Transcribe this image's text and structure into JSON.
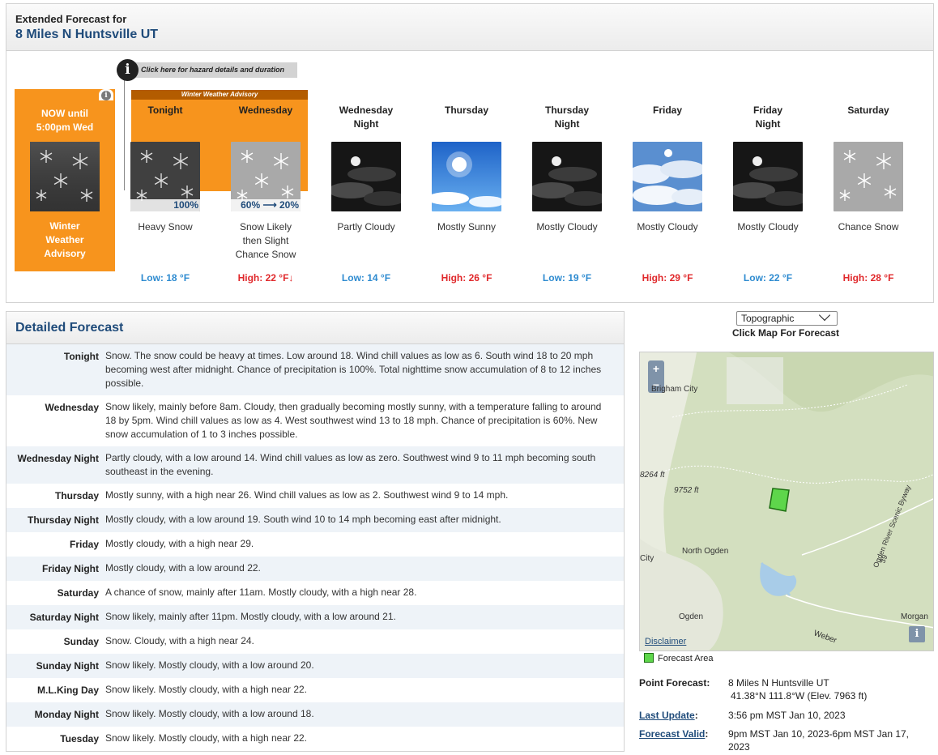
{
  "header": {
    "subtitle": "Extended Forecast for",
    "location": "8 Miles N Huntsville UT"
  },
  "hazard": {
    "button_label": "Click here for hazard details and duration",
    "advisory_label": "Winter Weather Advisory"
  },
  "now": {
    "label_line1": "NOW until",
    "label_line2": "5:00pm Wed",
    "cond_line1": "Winter",
    "cond_line2": "Weather",
    "cond_line3": "Advisory"
  },
  "periods": [
    {
      "name1": "Tonight",
      "name2": "",
      "pct": "100%",
      "d1": "Heavy Snow",
      "d2": "",
      "d3": "",
      "temp": "Low: 18 °F",
      "kind": "low",
      "icon": "snow-icon"
    },
    {
      "name1": "Wednesday",
      "name2": "",
      "pct": "60% ⟶ 20%",
      "d1": "Snow Likely",
      "d2": "then Slight",
      "d3": "Chance Snow",
      "temp": "High: 22 °F↓",
      "kind": "high",
      "icon": "snow-light-icon"
    },
    {
      "name1": "Wednesday",
      "name2": "Night",
      "pct": "",
      "d1": "Partly Cloudy",
      "d2": "",
      "d3": "",
      "temp": "Low: 14 °F",
      "kind": "low",
      "icon": "night-cloudy-icon"
    },
    {
      "name1": "Thursday",
      "name2": "",
      "pct": "",
      "d1": "Mostly Sunny",
      "d2": "",
      "d3": "",
      "temp": "High: 26 °F",
      "kind": "high",
      "icon": "sunny-icon"
    },
    {
      "name1": "Thursday",
      "name2": "Night",
      "pct": "",
      "d1": "Mostly Cloudy",
      "d2": "",
      "d3": "",
      "temp": "Low: 19 °F",
      "kind": "low",
      "icon": "night-cloudy-icon"
    },
    {
      "name1": "Friday",
      "name2": "",
      "pct": "",
      "d1": "Mostly Cloudy",
      "d2": "",
      "d3": "",
      "temp": "High: 29 °F",
      "kind": "high",
      "icon": "cloudy-icon"
    },
    {
      "name1": "Friday",
      "name2": "Night",
      "pct": "",
      "d1": "Mostly Cloudy",
      "d2": "",
      "d3": "",
      "temp": "Low: 22 °F",
      "kind": "low",
      "icon": "night-cloudy-icon"
    },
    {
      "name1": "Saturday",
      "name2": "",
      "pct": "",
      "d1": "Chance Snow",
      "d2": "",
      "d3": "",
      "temp": "High: 28 °F",
      "kind": "high",
      "icon": "snow-light-icon"
    }
  ],
  "detailed": {
    "title": "Detailed Forecast",
    "rows": [
      {
        "label": "Tonight",
        "text": "Snow. The snow could be heavy at times. Low around 18. Wind chill values as low as 6. South wind 18 to 20 mph becoming west after midnight. Chance of precipitation is 100%. Total nighttime snow accumulation of 8 to 12 inches possible."
      },
      {
        "label": "Wednesday",
        "text": "Snow likely, mainly before 8am. Cloudy, then gradually becoming mostly sunny, with a temperature falling to around 18 by 5pm. Wind chill values as low as 4. West southwest wind 13 to 18 mph. Chance of precipitation is 60%. New snow accumulation of 1 to 3 inches possible."
      },
      {
        "label": "Wednesday Night",
        "text": "Partly cloudy, with a low around 14. Wind chill values as low as zero. Southwest wind 9 to 11 mph becoming south southeast in the evening."
      },
      {
        "label": "Thursday",
        "text": "Mostly sunny, with a high near 26. Wind chill values as low as 2. Southwest wind 9 to 14 mph."
      },
      {
        "label": "Thursday Night",
        "text": "Mostly cloudy, with a low around 19. South wind 10 to 14 mph becoming east after midnight."
      },
      {
        "label": "Friday",
        "text": "Mostly cloudy, with a high near 29."
      },
      {
        "label": "Friday Night",
        "text": "Mostly cloudy, with a low around 22."
      },
      {
        "label": "Saturday",
        "text": "A chance of snow, mainly after 11am. Mostly cloudy, with a high near 28."
      },
      {
        "label": "Saturday Night",
        "text": "Snow likely, mainly after 11pm. Mostly cloudy, with a low around 21."
      },
      {
        "label": "Sunday",
        "text": "Snow. Cloudy, with a high near 24."
      },
      {
        "label": "Sunday Night",
        "text": "Snow likely. Mostly cloudy, with a low around 20."
      },
      {
        "label": "M.L.King Day",
        "text": "Snow likely. Mostly cloudy, with a high near 22."
      },
      {
        "label": "Monday Night",
        "text": "Snow likely. Mostly cloudy, with a low around 18."
      },
      {
        "label": "Tuesday",
        "text": "Snow likely. Mostly cloudy, with a high near 22."
      }
    ]
  },
  "map": {
    "selector_value": "Topographic",
    "caption": "Click Map For Forecast",
    "labels": {
      "brigham": "Brigham City",
      "e8264": "8264 ft",
      "e9752": "9752 ft",
      "north_ogden": "North Ogden",
      "city": "City",
      "ogden": "Ogden",
      "morgan": "Morgan",
      "weber": "Weber",
      "ogden_river": "Ogden River Scenic Byway",
      "r39": "39"
    },
    "zoom_in": "+",
    "zoom_out": "−",
    "disclaimer": "Disclaimer",
    "legend": "Forecast Area",
    "info": "i"
  },
  "point": {
    "label": "Point Forecast:",
    "name": "8 Miles N Huntsville UT",
    "coords": "41.38°N 111.8°W (Elev. 7963 ft)",
    "update_label": "Last Update",
    "update_colon": ":",
    "update_value": "3:56 pm MST Jan 10, 2023",
    "valid_label": "Forecast Valid",
    "valid_colon": ":",
    "valid_value_1": "9pm MST Jan 10, 2023-6pm MST Jan 17,",
    "valid_value_2": "2023"
  }
}
